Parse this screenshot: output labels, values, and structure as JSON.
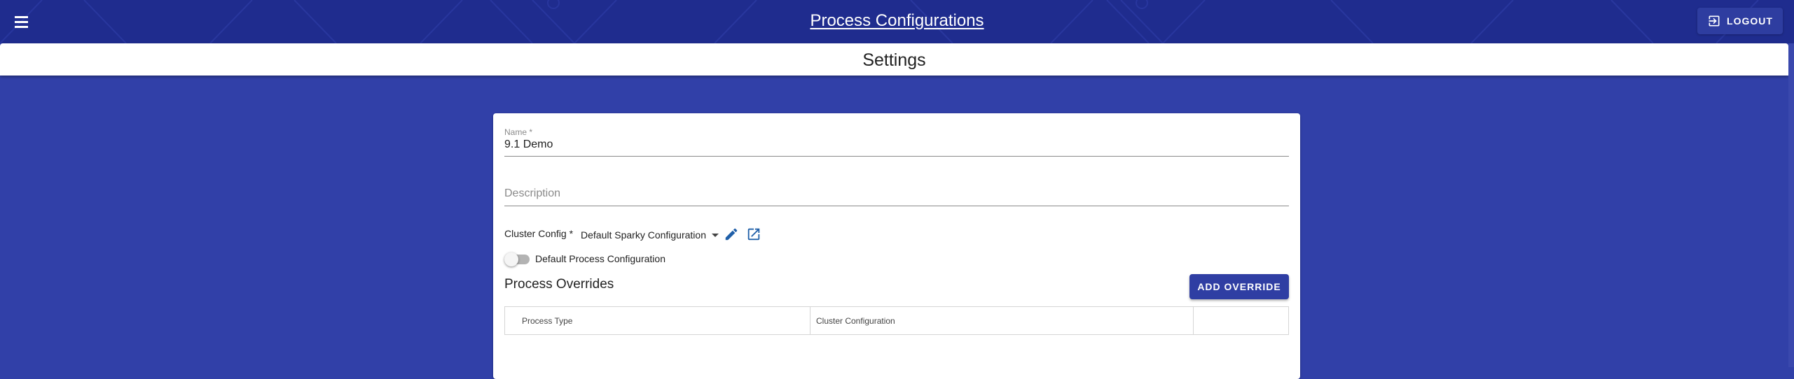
{
  "app_bar": {
    "title": "Process Configurations",
    "logout_label": "LOGOUT"
  },
  "page": {
    "title": "Settings"
  },
  "form": {
    "name": {
      "label": "Name *",
      "value": "9.1 Demo"
    },
    "description": {
      "label": "Description",
      "value": ""
    },
    "cluster_config": {
      "label": "Cluster Config *",
      "selected": "Default Sparky Configuration"
    },
    "default_toggle": {
      "label": "Default Process Configuration",
      "checked": false
    }
  },
  "overrides": {
    "title": "Process Overrides",
    "add_button_label": "ADD OVERRIDE",
    "columns": [
      "Process Type",
      "Cluster Configuration",
      ""
    ]
  },
  "colors": {
    "app_bar": "#1f2c8e",
    "background": "#3140a8",
    "primary_button": "#2f3ea3",
    "icon_accent": "#1f5fa8"
  },
  "icons": {
    "menu": "menu-icon",
    "logout": "logout-icon",
    "edit": "pencil-icon",
    "open": "open-in-new-icon"
  }
}
